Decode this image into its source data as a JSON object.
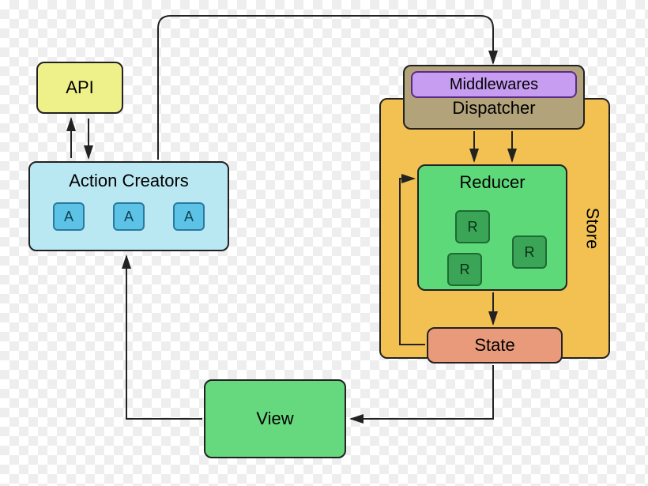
{
  "api": {
    "label": "API"
  },
  "action_creators": {
    "label": "Action Creators",
    "chips": [
      "A",
      "A",
      "A"
    ]
  },
  "view": {
    "label": "View"
  },
  "store": {
    "label": "Store"
  },
  "dispatcher": {
    "label": "Dispatcher",
    "middlewares_label": "Middlewares"
  },
  "reducer": {
    "label": "Reducer",
    "chips": [
      "R",
      "R",
      "R"
    ]
  },
  "state": {
    "label": "State"
  },
  "colors": {
    "api": "#eef08a",
    "action_creators": "#b9e8f2",
    "view": "#66d97e",
    "store": "#f2c152",
    "dispatcher": "#b3a37a",
    "middlewares": "#c79df2",
    "reducer": "#5ed97a",
    "state": "#e89a7a"
  }
}
